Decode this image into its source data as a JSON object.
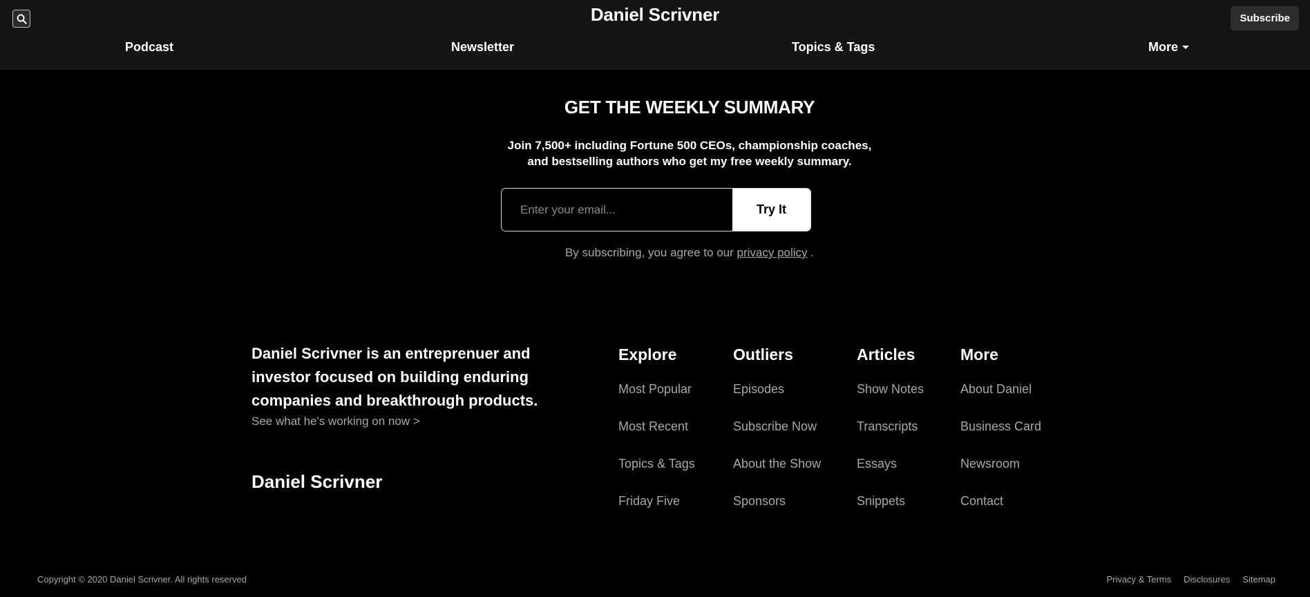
{
  "header": {
    "site_title": "Daniel Scrivner",
    "subscribe_label": "Subscribe",
    "search_icon": "search-icon"
  },
  "nav": {
    "items": [
      {
        "label": "Podcast"
      },
      {
        "label": "Newsletter"
      },
      {
        "label": "Topics & Tags"
      },
      {
        "label": "More"
      }
    ]
  },
  "newsletter": {
    "heading": "GET THE WEEKLY SUMMARY",
    "description": "Join 7,500+ including Fortune 500 CEOs, championship coaches, and bestselling authors who get my free weekly summary.",
    "email_placeholder": "Enter your email...",
    "button_label": "Try It",
    "legal_prefix": "By subscribing, you agree to our",
    "legal_link": "privacy policy",
    "legal_suffix": "."
  },
  "footer": {
    "about": "Daniel Scrivner is an entreprenuer and investor focused on building enduring companies and breakthrough products.",
    "about_link": "See what he's working on now >",
    "logo_text": "Daniel Scrivner",
    "columns": [
      {
        "title": "Explore",
        "links": [
          "Most Popular",
          "Most Recent",
          "Topics & Tags",
          "Friday Five"
        ]
      },
      {
        "title": "Outliers",
        "links": [
          "Episodes",
          "Subscribe Now",
          "About the Show",
          "Sponsors"
        ]
      },
      {
        "title": "Articles",
        "links": [
          "Show Notes",
          "Transcripts",
          "Essays",
          "Snippets"
        ]
      },
      {
        "title": "More",
        "links": [
          "About Daniel",
          "Business Card",
          "Newsroom",
          "Contact"
        ]
      }
    ],
    "copyright": "Copyright © 2020 Daniel Scrivner. All rights reserved",
    "legal_links": [
      "Privacy & Terms",
      "Disclosures",
      "Sitemap"
    ]
  },
  "colors": {
    "header_bg": "#151515",
    "page_bg": "#000000",
    "muted_text": "#a8a8a8"
  }
}
